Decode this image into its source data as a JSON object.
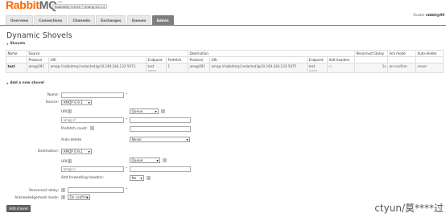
{
  "header": {
    "logo_left": "Rabbit",
    "logo_right": "MQ",
    "tm": "TM",
    "rabbit_version": "RabbitMQ 3.8.35",
    "erlang_version": "Erlang 25.1.2",
    "cluster_label": "Cluster",
    "cluster_name": "rabbit@99"
  },
  "tabs": [
    {
      "label": "Overview"
    },
    {
      "label": "Connections"
    },
    {
      "label": "Channels"
    },
    {
      "label": "Exchanges"
    },
    {
      "label": "Queues"
    },
    {
      "label": "Admin",
      "active": true
    }
  ],
  "page_title": "Dynamic Shovels",
  "shovels_section": "Shovels",
  "table": {
    "group_headers": {
      "name": "Name",
      "source": "Source",
      "destination": "Destination",
      "reconnect": "Reconnect Delay",
      "ack": "Ack mode",
      "autodel": "Auto-delete"
    },
    "sub_headers": [
      "Protocol",
      "URI",
      "Endpoint",
      "Prefetch",
      "Protocol",
      "URI",
      "Endpoint",
      "Add headers"
    ],
    "rows": [
      {
        "name": "test",
        "src_protocol": "amqp091",
        "src_uri": "amqp://rabbitmq:[redacted]@10.249.184.132:5673",
        "src_endpoint": "test",
        "src_endpoint_type": "queue",
        "prefetch": "1",
        "dst_protocol": "amqp091",
        "dst_uri": "amqp://rabbitmq:[redacted]@10.249.184.132:5675",
        "dst_endpoint": "test",
        "dst_endpoint_type": "queue",
        "add_headers": "○",
        "reconnect": "1s",
        "ack_mode": "on-confirm",
        "auto_delete": "never"
      }
    ]
  },
  "add_section": "Add a new shovel",
  "form": {
    "name_label": "Name:",
    "name_value": "",
    "source_label": "Source:",
    "source_protocol": "AMQP 0.9.1",
    "src_uri_label": "URI:",
    "src_uri_value": "amqp://",
    "src_endpoint_type": "Queue",
    "src_endpoint_value": "",
    "prefetch_label": "Prefetch count:",
    "prefetch_value": "",
    "autodelete_label": "Auto-delete",
    "autodelete_value": "Never",
    "dest_label": "Destination:",
    "dest_protocol": "AMQP 0.9.1",
    "dst_uri_label": "URI:",
    "dst_uri_value": "amqp://",
    "dst_endpoint_type": "Queue",
    "dst_endpoint_value": "",
    "add_fwd_label": "Add forwarding headers:",
    "add_fwd_value": "No",
    "reconnect_label": "Reconnect delay:",
    "reconnect_value": "",
    "ack_label": "Acknowledgement mode:",
    "ack_value": "On confirm",
    "star": "*",
    "help": "?",
    "submit": "Add shovel"
  },
  "watermark": "ctyun/莫****过"
}
